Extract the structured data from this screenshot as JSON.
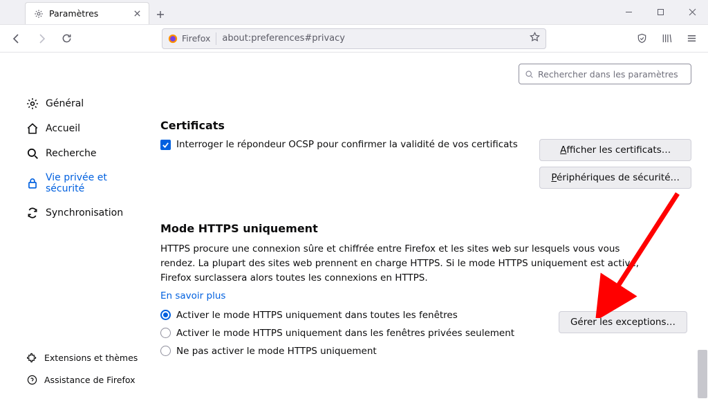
{
  "tab": {
    "title": "Paramètres"
  },
  "url": {
    "identity": "Firefox",
    "address": "about:preferences#privacy"
  },
  "search": {
    "placeholder": "Rechercher dans les paramètres"
  },
  "sidebar": {
    "items": [
      {
        "label": "Général"
      },
      {
        "label": "Accueil"
      },
      {
        "label": "Recherche"
      },
      {
        "label": "Vie privée et sécurité"
      },
      {
        "label": "Synchronisation"
      }
    ],
    "bottom": [
      {
        "label": "Extensions et thèmes"
      },
      {
        "label": "Assistance de Firefox"
      }
    ]
  },
  "certs": {
    "heading": "Certificats",
    "ocsp_pre": "I",
    "ocsp_rest": "nterroger le répondeur OCSP pour confirmer la validité de vos certificats",
    "view_pre": "A",
    "view_rest": "fficher les certificats…",
    "devices_pre": "P",
    "devices_rest": "ériphériques de sécurité…"
  },
  "https": {
    "heading": "Mode HTTPS uniquement",
    "desc": "HTTPS procure une connexion sûre et chiffrée entre Firefox et les sites web sur lesquels vous vous rendez. La plupart des sites web prennent en charge HTTPS. Si le mode HTTPS uniquement est activé, Firefox surclassera alors toutes les connexions en HTTPS.",
    "learn": "En savoir plus",
    "options": [
      "Activer le mode HTTPS uniquement dans toutes les fenêtres",
      "Activer le mode HTTPS uniquement dans les fenêtres privées seulement",
      "Ne pas activer le mode HTTPS uniquement"
    ],
    "exceptions": "Gérer les exceptions…"
  }
}
